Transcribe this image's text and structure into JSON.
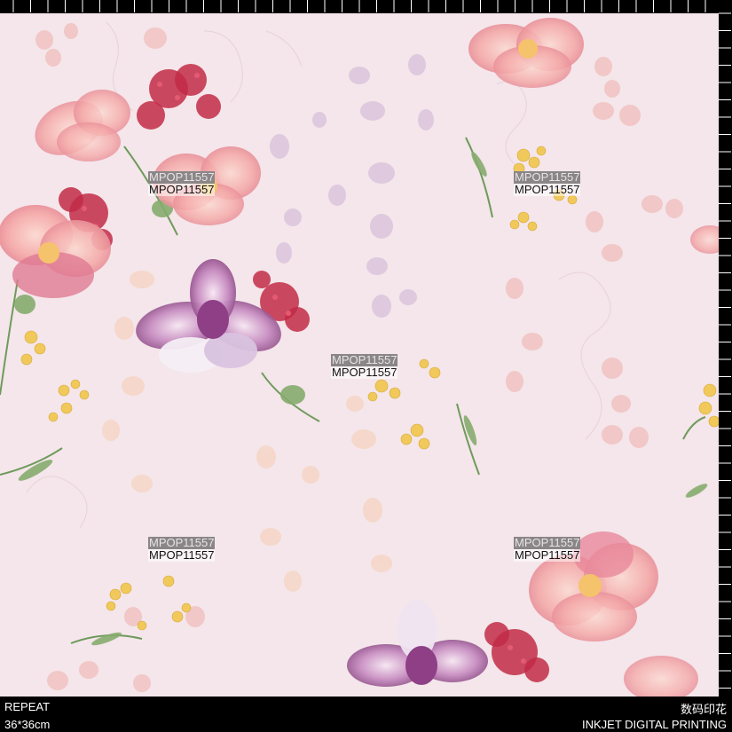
{
  "pattern_code": "MPOP11557",
  "footer": {
    "left_top": "REPEAT",
    "left_bottom": "36*36cm",
    "right_top": "数码印花",
    "right_bottom": "INKJET DIGITAL PRINTING"
  },
  "colors": {
    "background": "#f4e6ea",
    "frame": "#000000",
    "pink_flower": "#f2a7a6",
    "magenta_flower": "#9b4f8c",
    "red_berries": "#c22b46",
    "yellow_flower": "#f0c95a",
    "leaf_green": "#6f9a5c",
    "lilac_motif": "#cdb3d6",
    "peach_motif": "#f6d2b8"
  },
  "icons": [
    "ruler-ticks",
    "watermark"
  ]
}
